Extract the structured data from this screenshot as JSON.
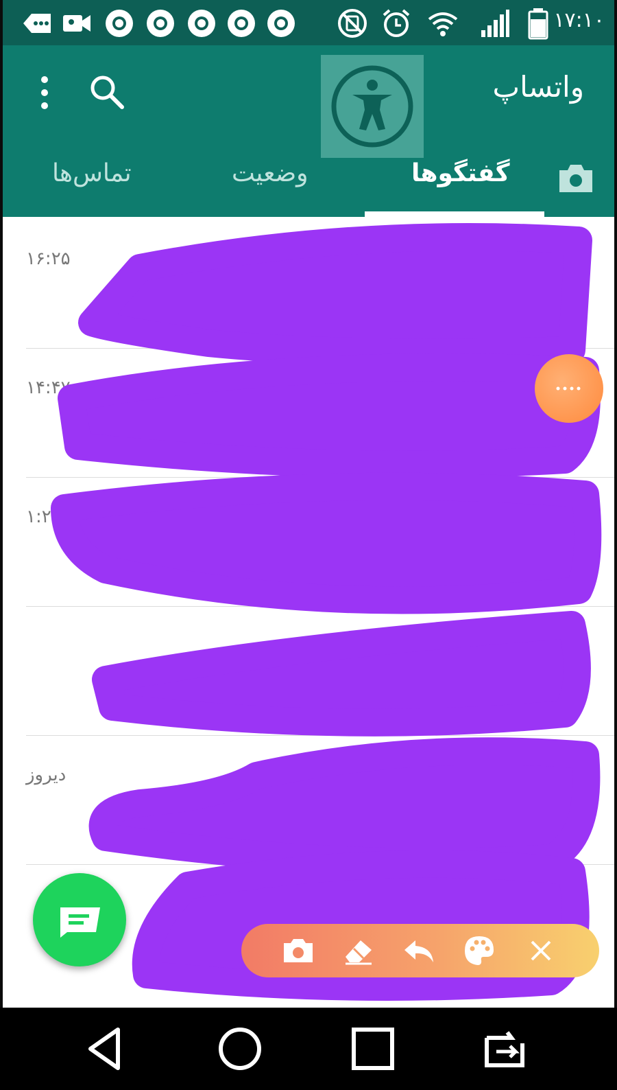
{
  "status_bar": {
    "time": "۱۷:۱۰",
    "icons": [
      "more-notifications-icon",
      "video-call-icon",
      "chrome-icon",
      "chrome-icon",
      "chrome-icon",
      "chrome-icon",
      "chrome-icon",
      "nfc-off-icon",
      "alarm-icon",
      "wifi-icon",
      "signal-icon",
      "battery-icon"
    ]
  },
  "app_bar": {
    "title": "واتساپ",
    "icons": [
      "more-options-icon",
      "search-icon",
      "accessibility-icon"
    ]
  },
  "tabs": [
    {
      "label": "گفتگوها",
      "active": true
    },
    {
      "label": "وضعیت",
      "active": false
    },
    {
      "label": "تماس‌ها",
      "active": false
    }
  ],
  "chat_list": [
    {
      "time": "۱۶:۲۵"
    },
    {
      "time": "۱۴:۴۷"
    },
    {
      "time": "۱:۲"
    },
    {
      "time": ""
    },
    {
      "time": "دیروز"
    },
    {
      "time": ""
    }
  ],
  "overlay_toolbar": {
    "buttons": [
      "camera-icon",
      "eraser-icon",
      "undo-icon",
      "palette-icon",
      "close-icon"
    ]
  },
  "nav_bar": {
    "buttons": [
      "back-icon",
      "home-icon",
      "recents-icon",
      "switch-app-icon"
    ]
  },
  "colors": {
    "status_bar": "#0d5f55",
    "app_bar": "#0e7c6e",
    "fab": "#1ed35c",
    "scribble": "#9b35f5",
    "bubble": "#ff8a3d"
  }
}
